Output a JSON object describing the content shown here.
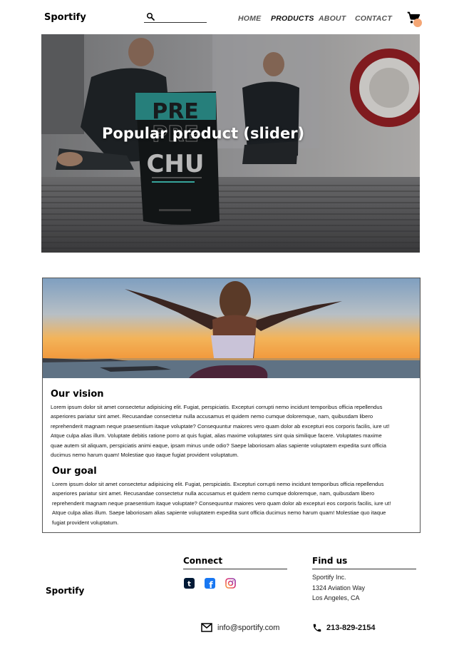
{
  "header": {
    "brand": "Sportify",
    "nav": [
      "HOME",
      "PRODUCTS",
      "ABOUT",
      "CONTACT"
    ],
    "active_nav": "PRODUCTS"
  },
  "hero": {
    "title": "Popular product (slider)",
    "product_text": [
      "PRE",
      "CHU"
    ]
  },
  "vision": {
    "heading": "Our vision",
    "lines": [
      "Lorem ipsum dolor sit amet consectetur adipisicing elit. Fugiat, perspiciatis. Excepturi corrupti nemo incidunt temporibus officia repellendus",
      "asperiores pariatur sint amet. Recusandae consectetur nulla accusamus et quidem nemo cumque doloremque, nam, quibusdam libero",
      "reprehenderit magnam neque praesentium itaque voluptate? Consequuntur maiores vero quam dolor ab excepturi eos corporis facilis, iure ut!",
      "Atque culpa alias illum. Voluptate debitis ratione porro at quis fugiat, alias maxime voluptates sint quia similique facere. Voluptates maxime",
      "quae autem sit aliquam, perspiciatis animi eaque, ipsam minus unde odio? Saepe laboriosam alias sapiente voluptatem expedita sunt officia",
      "ducimus nemo harum quam! Molestiae quo itaque fugiat provident voluptatum."
    ]
  },
  "goal": {
    "heading": "Our goal",
    "lines": [
      "Lorem ipsum dolor sit amet consectetur adipisicing elit. Fugiat, perspiciatis. Excepturi corrupti nemo incidunt temporibus officia repellendus",
      "asperiores pariatur sint amet. Recusandae consectetur nulla accusamus et quidem nemo cumque doloremque, nam, quibusdam libero",
      "reprehenderit magnam neque praesentium itaque voluptate? Consequuntur maiores vero quam dolor ab excepturi eos corporis facilis, iure ut!",
      "Atque culpa alias illum. Saepe laboriosam alias sapiente voluptatem expedita sunt officia ducimus nemo harum quam! Molestiae quo itaque",
      "fugiat provident voluptatum."
    ]
  },
  "footer": {
    "brand": "Sportify",
    "connect_heading": "Connect",
    "findus_heading": "Find us",
    "address": [
      "Sportify Inc.",
      "1324 Aviation Way",
      "Los Angeles, CA"
    ],
    "email": "info@sportify.com",
    "phone": "213-829-2154",
    "social_icons": [
      "tumblr-icon",
      "facebook-icon",
      "instagram-icon"
    ]
  },
  "colors": {
    "cart_badge": "#f4a675",
    "tumblr": "#001935",
    "facebook": "#1877f2"
  }
}
